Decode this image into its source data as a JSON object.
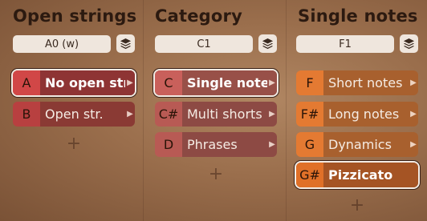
{
  "columns": [
    {
      "title": "Open strings",
      "key_value": "A0 (w)",
      "items": [
        {
          "key": "A",
          "label": "No open str"
        },
        {
          "key": "B",
          "label": "Open str."
        }
      ]
    },
    {
      "title": "Category",
      "key_value": "C1",
      "items": [
        {
          "key": "C",
          "label": "Single notes"
        },
        {
          "key": "C#",
          "label": "Multi shorts"
        },
        {
          "key": "D",
          "label": "Phrases"
        }
      ]
    },
    {
      "title": "Single notes",
      "key_value": "F1",
      "items": [
        {
          "key": "F",
          "label": "Short notes"
        },
        {
          "key": "F#",
          "label": "Long notes"
        },
        {
          "key": "G",
          "label": "Dynamics"
        },
        {
          "key": "G#",
          "label": "Pizzicato"
        }
      ]
    }
  ],
  "icons": {
    "layers": "layers-icon",
    "arrow": "chevron-right-icon",
    "add": "plus-icon"
  },
  "add_symbol": "+",
  "colors": {
    "col1_key": "#d14747",
    "col2_key": "#c9605b",
    "col3_key": "#e47a32"
  }
}
